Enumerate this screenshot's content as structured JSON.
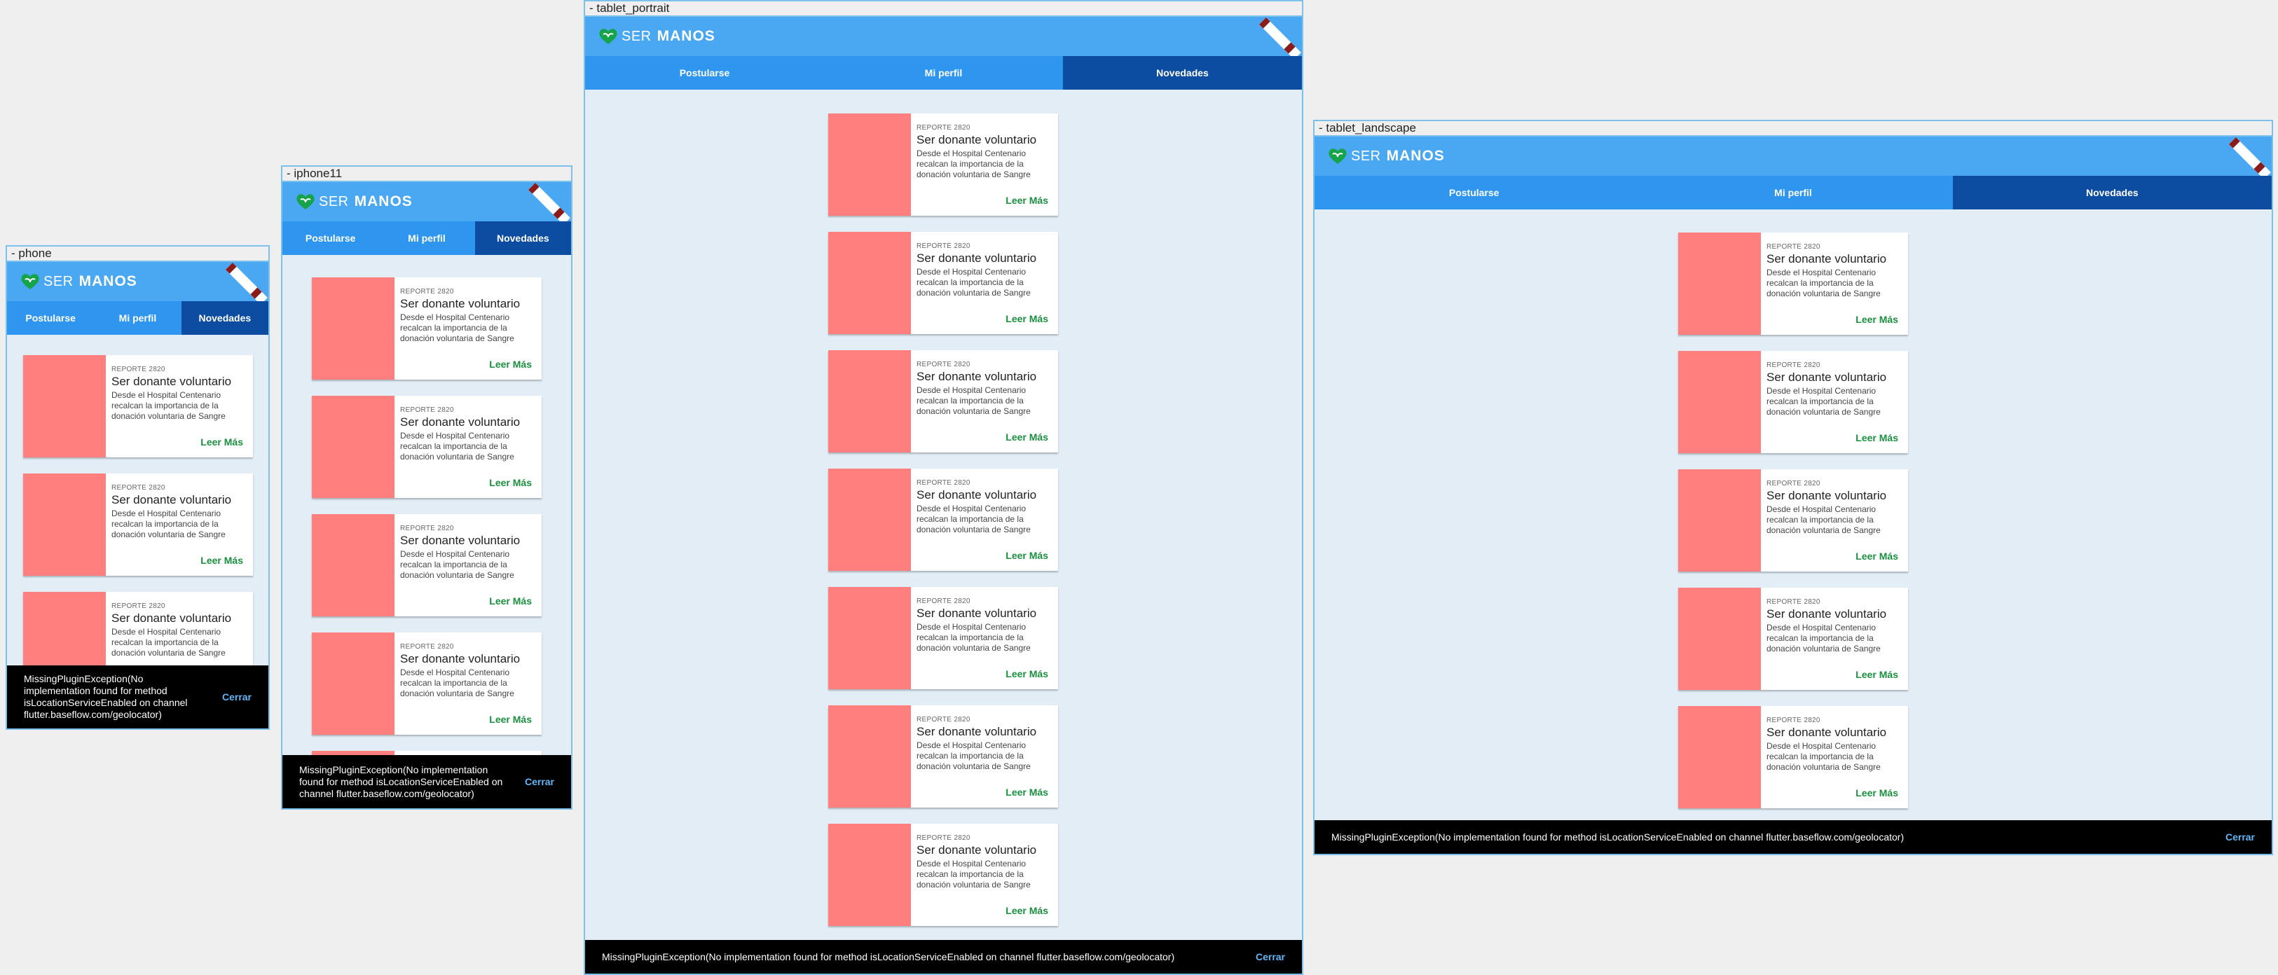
{
  "devices": {
    "phone": {
      "label": "- phone"
    },
    "iphone11": {
      "label": "- iphone11"
    },
    "tablet_portrait": {
      "label": "- tablet_portrait"
    },
    "tablet_landscape": {
      "label": "- tablet_landscape"
    }
  },
  "app": {
    "logo_ser": "SER",
    "logo_manos": "MANOS",
    "tabs": [
      "Postularse",
      "Mi perfil",
      "Novedades"
    ],
    "active_tab": "Novedades"
  },
  "card": {
    "overline": "REPORTE 2820",
    "title": "Ser donante voluntario",
    "text": "Desde el Hospital Centenario recalcan la importancia de la donación voluntaria de Sangre",
    "link": "Leer Más"
  },
  "snackbar": {
    "message": "MissingPluginException(No implementation found for method isLocationServiceEnabled on channel flutter.baseflow.com/geolocator)",
    "action": "Cerrar"
  },
  "colors": {
    "appbar": "#4aa7f1",
    "tabbar": "#2e96ee",
    "tab_active": "#0d4da1",
    "background": "#e3edf6",
    "card_image": "#ff7f7f",
    "link": "#1a8f3f",
    "snackbar_action": "#64b5f6"
  }
}
